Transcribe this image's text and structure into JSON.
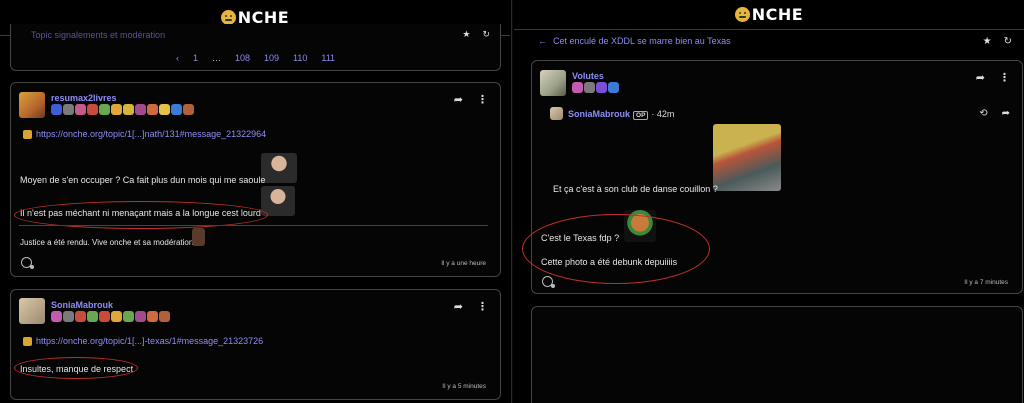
{
  "brand": {
    "logo_text": "NCHE"
  },
  "left": {
    "top_clipped_text": "Topic signalements et modération",
    "pagination": [
      "‹",
      "1",
      "…",
      "108",
      "109",
      "110",
      "111"
    ],
    "posts": [
      {
        "username": "resumax2livres",
        "link": "https://onche.org/topic/1[...]nath/131#message_21322964",
        "lines": [
          "Moyen de s'en occuper ? Ca fait plus dun mois qui me saoule",
          "Il n'est pas méchant ni menaçant mais a la longue cest lourd"
        ],
        "footer_text": "Justice a été rendu. Vive onche et sa modération!",
        "time": "Il y a une heure"
      },
      {
        "username": "SoniaMabrouk",
        "link": "https://onche.org/topic/1[...]-texas/1#message_21323726",
        "lines": [
          "Insultes, manque de respect"
        ],
        "time": "Il y a 5 minutes"
      }
    ]
  },
  "right": {
    "topic_title": "Cet enculé de XDDL se marre bien au Texas",
    "post": {
      "username": "Volutes",
      "quote_user": "SoniaMabrouk",
      "op_label": "OP",
      "quote_time": "· 42m",
      "quote_text": "Et ça c'est à son club de danse couillon ?",
      "line1": "C'est le Texas fdp ?",
      "line2": "Cette photo a été debunk depuiiiis",
      "time": "Il y a 7 minutes"
    }
  },
  "colors": {
    "accent": "#8d8df5",
    "annotation": "#c0302a",
    "border": "#444444"
  },
  "icons": [
    "share-icon",
    "kebab-menu-icon",
    "star-icon",
    "refresh-icon",
    "history-icon",
    "react-icon",
    "back-arrow-icon"
  ]
}
